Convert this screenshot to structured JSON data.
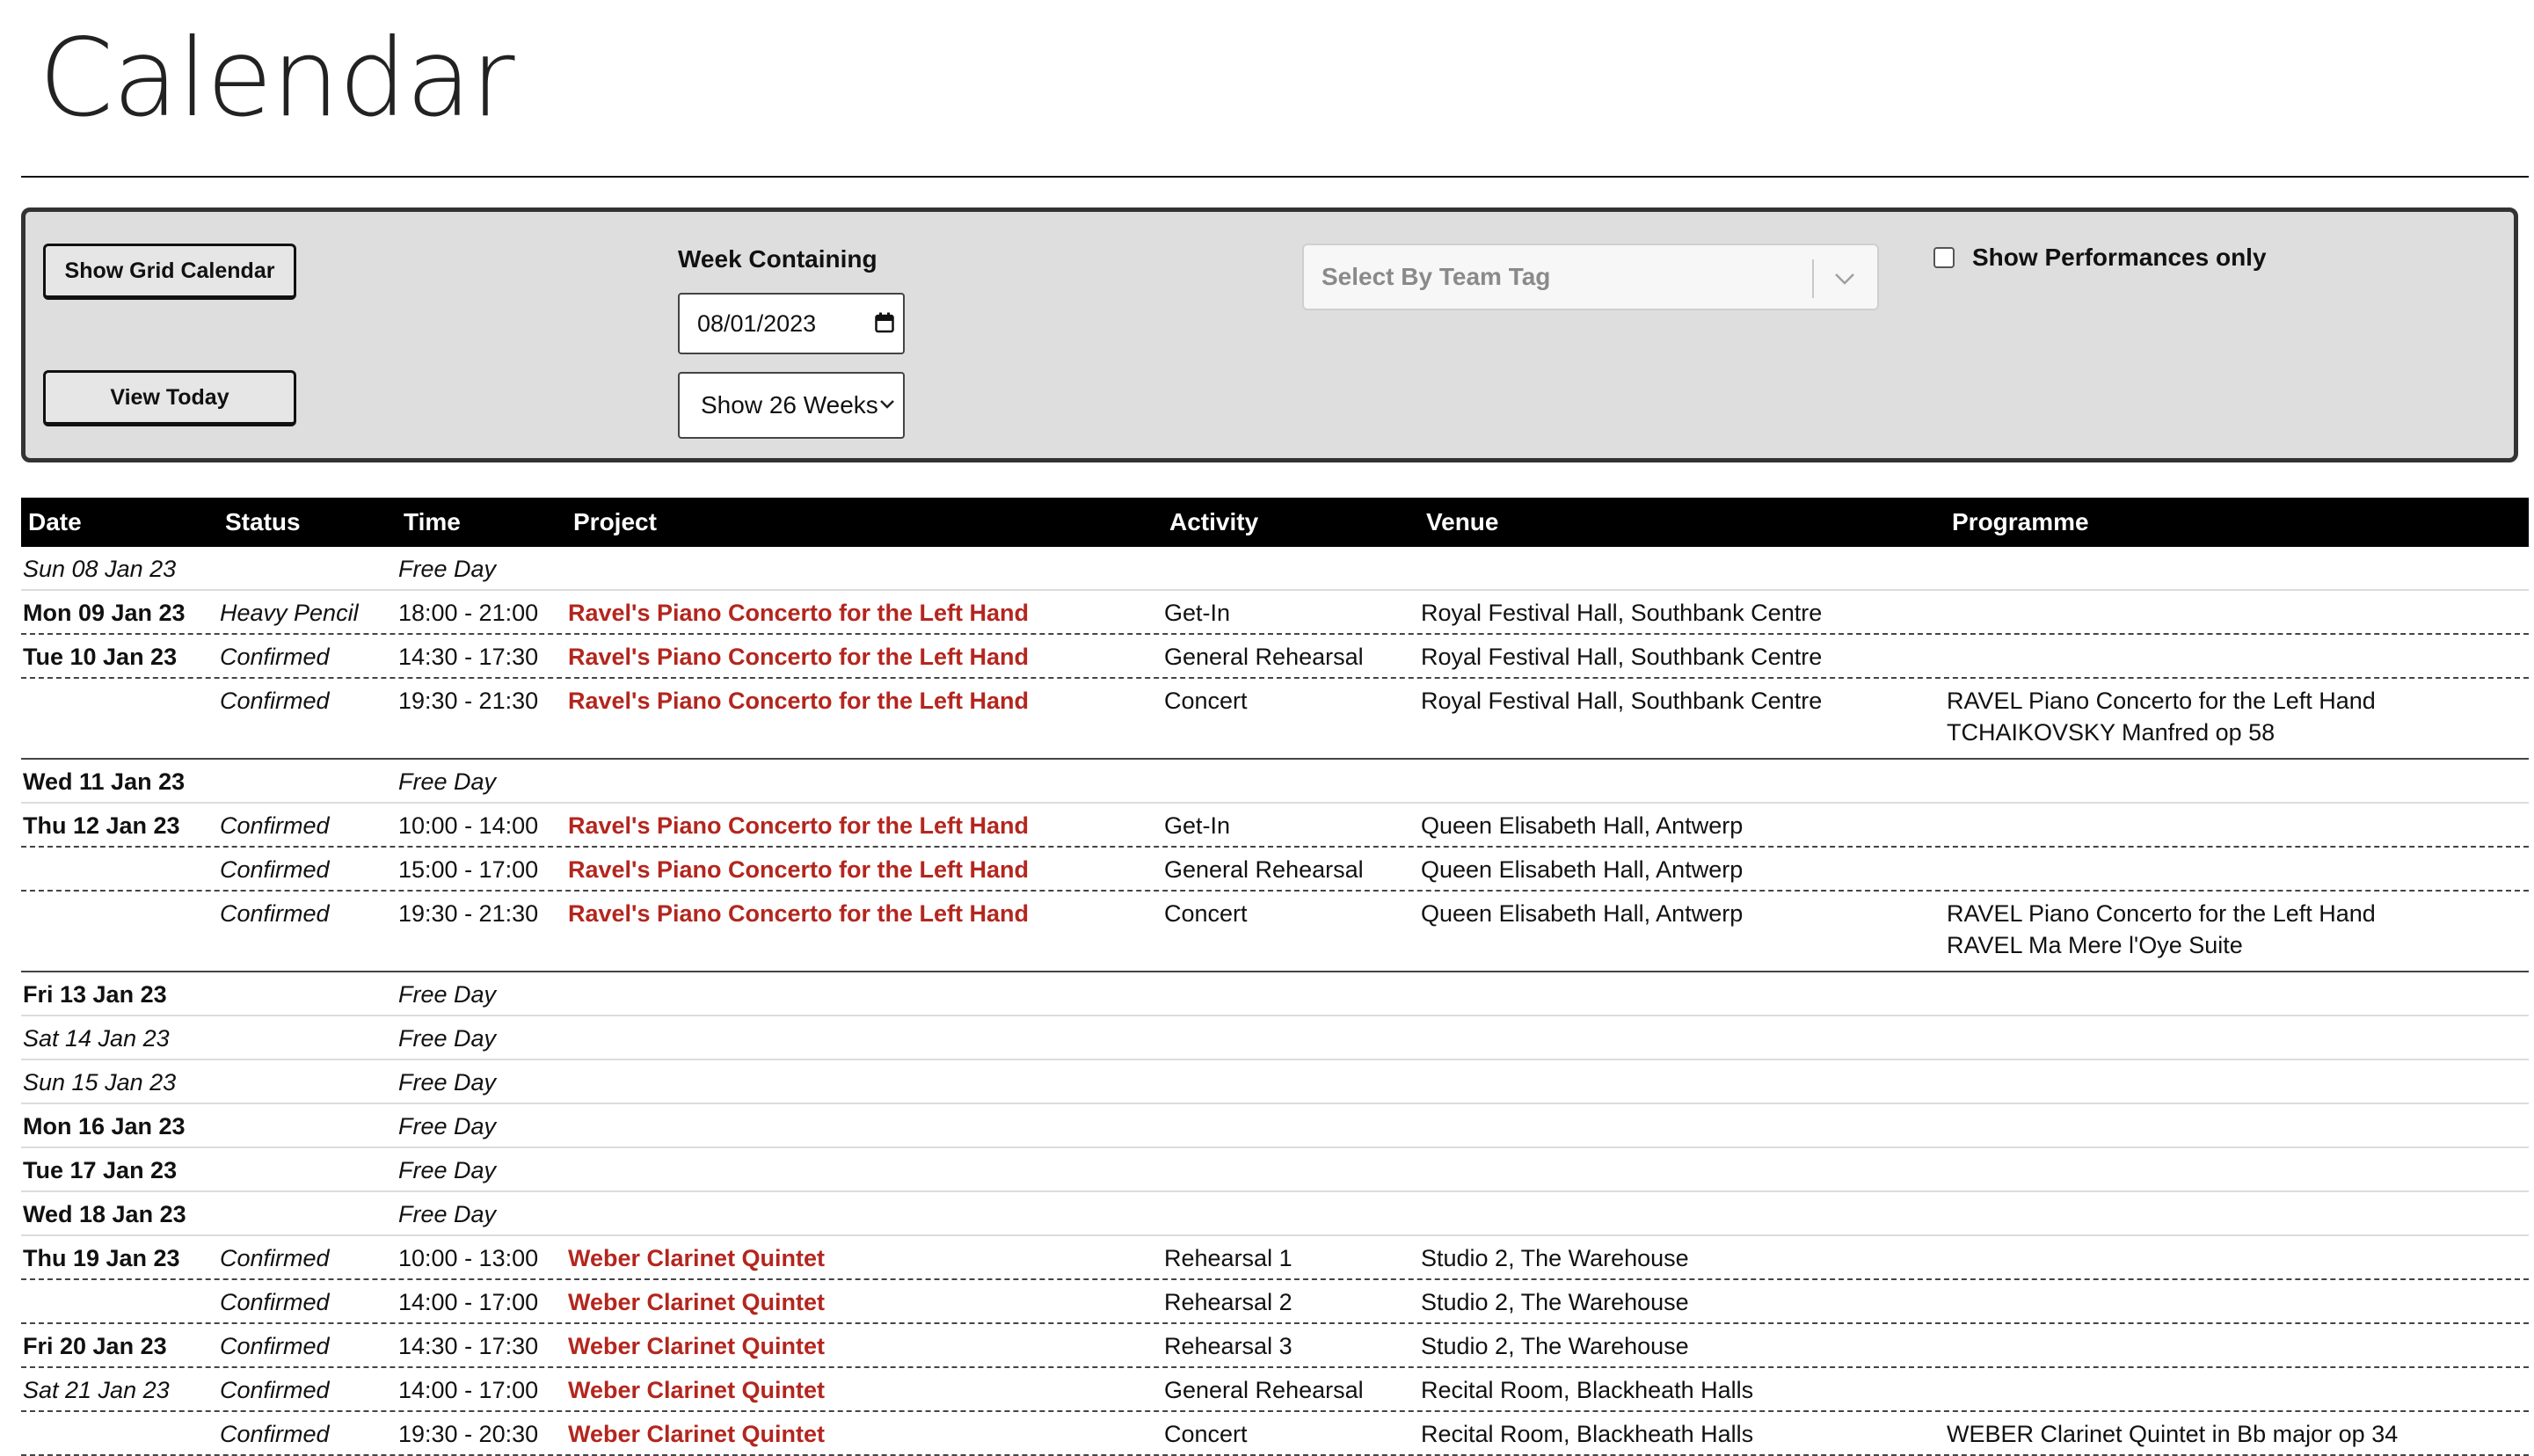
{
  "page": {
    "title": "Calendar"
  },
  "controls": {
    "show_grid_calendar": "Show Grid Calendar",
    "view_today": "View Today",
    "week_containing_label": "Week Containing",
    "week_date_value": "08/01/2023",
    "weeks_select_value": "Show 26 Weeks",
    "team_tag_placeholder": "Select By Team Tag",
    "show_performances_label": "Show Performances only"
  },
  "table": {
    "headers": {
      "date": "Date",
      "status": "Status",
      "time": "Time",
      "project": "Project",
      "activity": "Activity",
      "venue": "Venue",
      "programme": "Programme"
    },
    "rows": [
      {
        "date": "Sun 08 Jan 23",
        "date_style": "ital",
        "status": "",
        "time": "Free Day",
        "project": "",
        "activity": "",
        "venue": "",
        "programme": []
      },
      {
        "date": "Mon 09 Jan 23",
        "date_style": "bold",
        "status": "Heavy Pencil",
        "time": "18:00 - 21:00",
        "project": "Ravel's Piano Concerto for the Left Hand",
        "activity": "Get-In",
        "venue": "Royal Festival Hall, Southbank Centre",
        "programme": []
      },
      {
        "date": "Tue 10 Jan 23",
        "date_style": "bold",
        "status": "Confirmed",
        "time": "14:30 - 17:30",
        "project": "Ravel's Piano Concerto for the Left Hand",
        "activity": "General Rehearsal",
        "venue": "Royal Festival Hall, Southbank Centre",
        "programme": []
      },
      {
        "date": "",
        "date_style": "bold",
        "status": "Confirmed",
        "time": "19:30 - 21:30",
        "project": "Ravel's Piano Concerto for the Left Hand",
        "activity": "Concert",
        "venue": "Royal Festival Hall, Southbank Centre",
        "programme": [
          "RAVEL Piano Concerto for the Left Hand",
          "TCHAIKOVSKY Manfred op 58"
        ]
      },
      {
        "date": "Wed 11 Jan 23",
        "date_style": "bold",
        "status": "",
        "time": "Free Day",
        "project": "",
        "activity": "",
        "venue": "",
        "programme": []
      },
      {
        "date": "Thu 12 Jan 23",
        "date_style": "bold",
        "status": "Confirmed",
        "time": "10:00 - 14:00",
        "project": "Ravel's Piano Concerto for the Left Hand",
        "activity": "Get-In",
        "venue": "Queen Elisabeth Hall, Antwerp",
        "programme": []
      },
      {
        "date": "",
        "date_style": "bold",
        "status": "Confirmed",
        "time": "15:00 - 17:00",
        "project": "Ravel's Piano Concerto for the Left Hand",
        "activity": "General Rehearsal",
        "venue": "Queen Elisabeth Hall, Antwerp",
        "programme": []
      },
      {
        "date": "",
        "date_style": "bold",
        "status": "Confirmed",
        "time": "19:30 - 21:30",
        "project": "Ravel's Piano Concerto for the Left Hand",
        "activity": "Concert",
        "venue": "Queen Elisabeth Hall, Antwerp",
        "programme": [
          "RAVEL Piano Concerto for the Left Hand",
          "RAVEL Ma Mere l'Oye Suite"
        ]
      },
      {
        "date": "Fri 13 Jan 23",
        "date_style": "bold",
        "status": "",
        "time": "Free Day",
        "project": "",
        "activity": "",
        "venue": "",
        "programme": []
      },
      {
        "date": "Sat 14 Jan 23",
        "date_style": "ital",
        "status": "",
        "time": "Free Day",
        "project": "",
        "activity": "",
        "venue": "",
        "programme": []
      },
      {
        "date": "Sun 15 Jan 23",
        "date_style": "ital",
        "status": "",
        "time": "Free Day",
        "project": "",
        "activity": "",
        "venue": "",
        "programme": []
      },
      {
        "date": "Mon 16 Jan 23",
        "date_style": "bold",
        "status": "",
        "time": "Free Day",
        "project": "",
        "activity": "",
        "venue": "",
        "programme": []
      },
      {
        "date": "Tue 17 Jan 23",
        "date_style": "bold",
        "status": "",
        "time": "Free Day",
        "project": "",
        "activity": "",
        "venue": "",
        "programme": []
      },
      {
        "date": "Wed 18 Jan 23",
        "date_style": "bold",
        "status": "",
        "time": "Free Day",
        "project": "",
        "activity": "",
        "venue": "",
        "programme": []
      },
      {
        "date": "Thu 19 Jan 23",
        "date_style": "bold",
        "status": "Confirmed",
        "time": "10:00 - 13:00",
        "project": "Weber Clarinet Quintet",
        "activity": "Rehearsal 1",
        "venue": "Studio 2, The Warehouse",
        "programme": []
      },
      {
        "date": "",
        "date_style": "bold",
        "status": "Confirmed",
        "time": "14:00 - 17:00",
        "project": "Weber Clarinet Quintet",
        "activity": "Rehearsal 2",
        "venue": "Studio 2, The Warehouse",
        "programme": []
      },
      {
        "date": "Fri 20 Jan 23",
        "date_style": "bold",
        "status": "Confirmed",
        "time": "14:30 - 17:30",
        "project": "Weber Clarinet Quintet",
        "activity": "Rehearsal 3",
        "venue": "Studio 2, The Warehouse",
        "programme": []
      },
      {
        "date": "Sat 21 Jan 23",
        "date_style": "ital",
        "status": "Confirmed",
        "time": "14:00 - 17:00",
        "project": "Weber Clarinet Quintet",
        "activity": "General Rehearsal",
        "venue": "Recital Room, Blackheath Halls",
        "programme": []
      },
      {
        "date": "",
        "date_style": "ital",
        "status": "Confirmed",
        "time": "19:30 - 20:30",
        "project": "Weber Clarinet Quintet",
        "activity": "Concert",
        "venue": "Recital Room, Blackheath Halls",
        "programme": [
          "WEBER Clarinet Quintet in Bb major op 34"
        ]
      }
    ]
  }
}
